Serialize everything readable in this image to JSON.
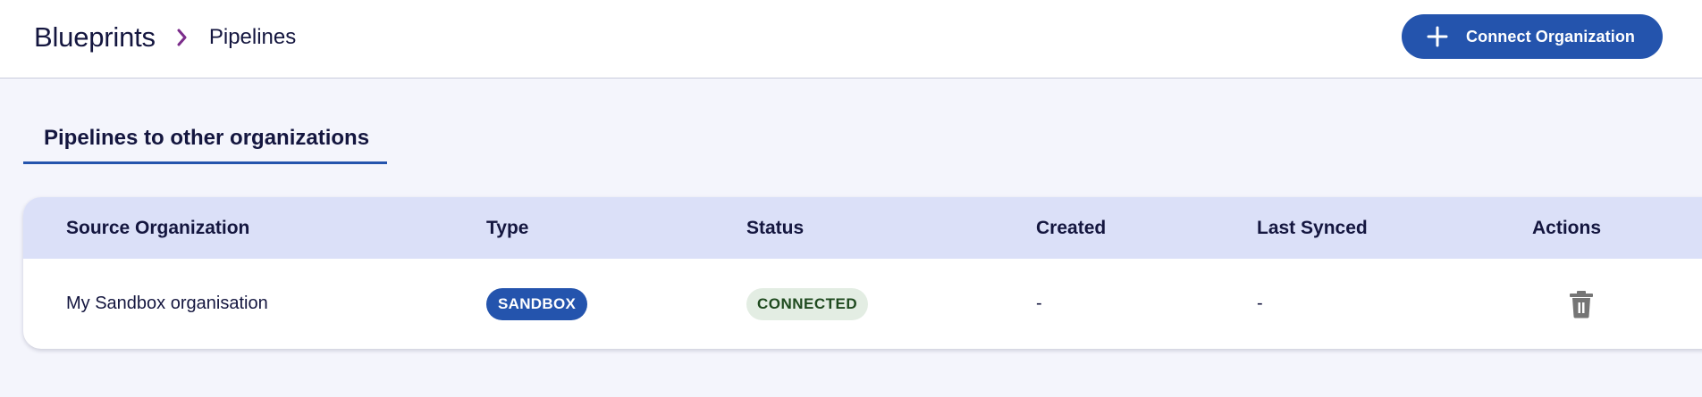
{
  "header": {
    "breadcrumb_root": "Blueprints",
    "breadcrumb_current": "Pipelines",
    "connect_button_label": "Connect Organization"
  },
  "tabs": [
    {
      "label": "Pipelines to other organizations",
      "active": true
    }
  ],
  "table": {
    "columns": [
      "Source Organization",
      "Type",
      "Status",
      "Created",
      "Last Synced",
      "Actions"
    ],
    "rows": [
      {
        "source_organization": "My Sandbox organisation",
        "type": "SANDBOX",
        "status": "CONNECTED",
        "created": "-",
        "last_synced": "-",
        "actions": [
          "delete"
        ]
      }
    ]
  },
  "icons": {
    "breadcrumb_separator": "chevron-right-icon",
    "connect_button": "plus-icon",
    "delete_action": "trash-icon"
  },
  "colors": {
    "primary": "#2454ad",
    "breadcrumb_chevron": "#7b2d8b",
    "header_row": "#dbe0f8",
    "page_background": "#f4f5fc",
    "status_connected_bg": "#e3ede3",
    "status_connected_text": "#1f4a1f",
    "text": "#14163f",
    "icon_gray": "#757575"
  }
}
